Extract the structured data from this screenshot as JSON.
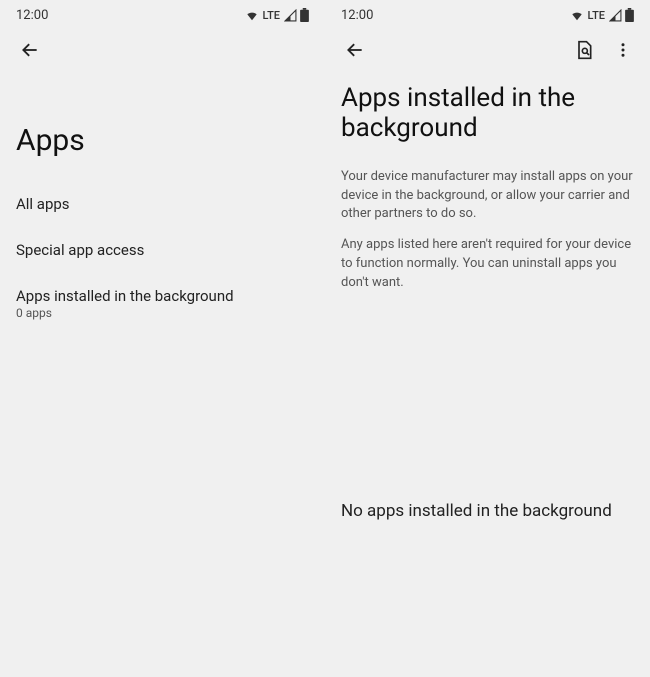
{
  "status": {
    "time": "12:00",
    "network": "LTE"
  },
  "left": {
    "title": "Apps",
    "items": [
      {
        "title": "All apps",
        "subtitle": ""
      },
      {
        "title": "Special app access",
        "subtitle": ""
      },
      {
        "title": "Apps installed in the background",
        "subtitle": "0 apps"
      }
    ]
  },
  "right": {
    "title": "Apps installed in the background",
    "paragraph1": "Your device manufacturer may install apps on your device in the background, or allow your carrier and other partners to do so.",
    "paragraph2": "Any apps listed here aren't required for your device to function normally. You can uninstall apps you don't want.",
    "empty_state": "No apps installed in the background"
  }
}
